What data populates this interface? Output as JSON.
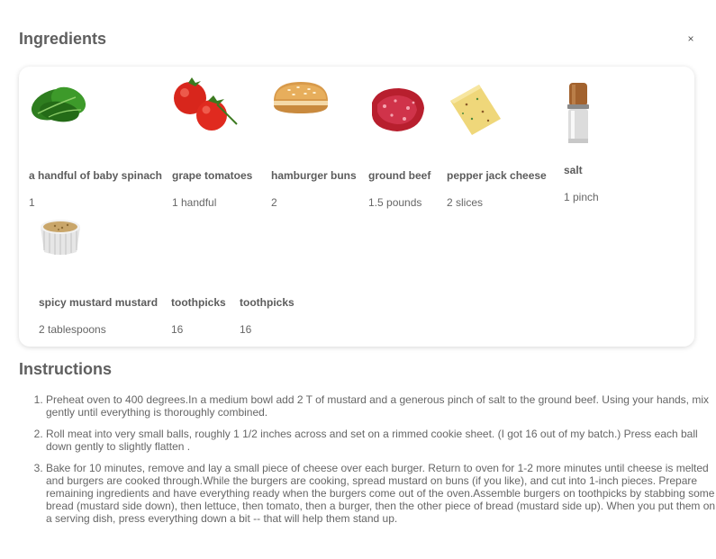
{
  "ingredients_section": {
    "title": "Ingredients",
    "close_label": "×",
    "items": [
      {
        "name": "a handful of baby spinach",
        "quantity": "1",
        "icon": "spinach-icon"
      },
      {
        "name": "grape tomatoes",
        "quantity": "1 handful",
        "icon": "tomatoes-icon"
      },
      {
        "name": "hamburger buns",
        "quantity": "2",
        "icon": "bun-icon"
      },
      {
        "name": "ground beef",
        "quantity": "1.5 pounds",
        "icon": "ground-beef-icon"
      },
      {
        "name": "pepper jack cheese",
        "quantity": "2 slices",
        "icon": "cheese-icon"
      },
      {
        "name": "salt",
        "quantity": "1 pinch",
        "icon": "salt-grinder-icon"
      },
      {
        "name": "spicy mustard mustard",
        "quantity": "2 tablespoons",
        "icon": "mustard-ramekin-icon"
      },
      {
        "name": "toothpicks",
        "quantity": "16",
        "icon": ""
      },
      {
        "name": "toothpicks",
        "quantity": "16",
        "icon": ""
      }
    ]
  },
  "instructions_section": {
    "title": "Instructions",
    "steps": [
      "Preheat oven to 400 degrees.In a medium bowl add 2 T of mustard and a generous pinch of salt to the ground beef. Using your hands, mix gently until everything is thoroughly combined.",
      "Roll meat into very small balls, roughly 1 1/2 inches across and set on a rimmed cookie sheet. (I got 16 out of my batch.) Press each ball down gently to slightly flatten .",
      "Bake for 10 minutes, remove and lay a small piece of cheese over each burger. Return to oven for 1-2 more minutes until cheese is melted and burgers are cooked through.While the burgers are cooking, spread mustard on buns (if you like), and cut into 1-inch pieces. Prepare remaining ingredients and have everything ready when the burgers come out of the oven.Assemble burgers on toothpicks by stabbing some bread (mustard side down), then lettuce, then tomato, then a burger, then the other piece of bread (mustard side up). When you put them on a serving dish, press everything down a bit -- that will help them stand up."
    ]
  }
}
